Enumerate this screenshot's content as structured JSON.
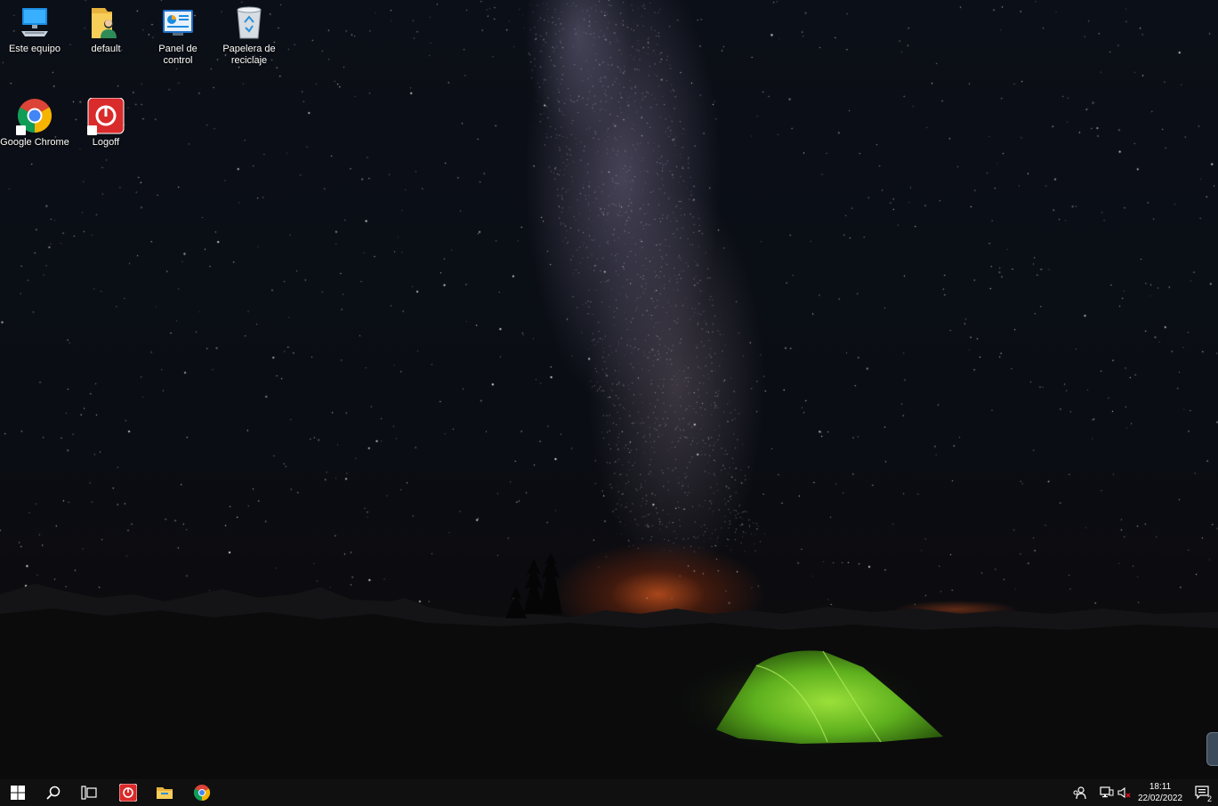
{
  "desktop_icons": [
    {
      "id": "this-pc",
      "label": "Este equipo"
    },
    {
      "id": "user-folder",
      "label": "default"
    },
    {
      "id": "control-panel",
      "label": "Panel de control"
    },
    {
      "id": "recycle-bin",
      "label": "Papelera de reciclaje"
    },
    {
      "id": "chrome",
      "label": "Google Chrome"
    },
    {
      "id": "logoff",
      "label": "Logoff"
    }
  ],
  "taskbar": {
    "buttons": [
      "windows-start-icon",
      "search-icon",
      "task-view-icon",
      "logoff-icon",
      "file-explorer-icon",
      "chrome-icon"
    ],
    "tray": [
      "people-icon",
      "network-icon",
      "volume-muted-icon"
    ],
    "clock": {
      "time": "18:11",
      "date": "22/02/2022"
    },
    "notifications_count": "2",
    "colors": {
      "taskbar_bg": "#101010",
      "chrome_red": "#db4437",
      "chrome_green": "#0f9d58",
      "chrome_yellow": "#f4b400",
      "chrome_blue": "#4285f4",
      "logoff_red": "#d92b2b"
    }
  }
}
